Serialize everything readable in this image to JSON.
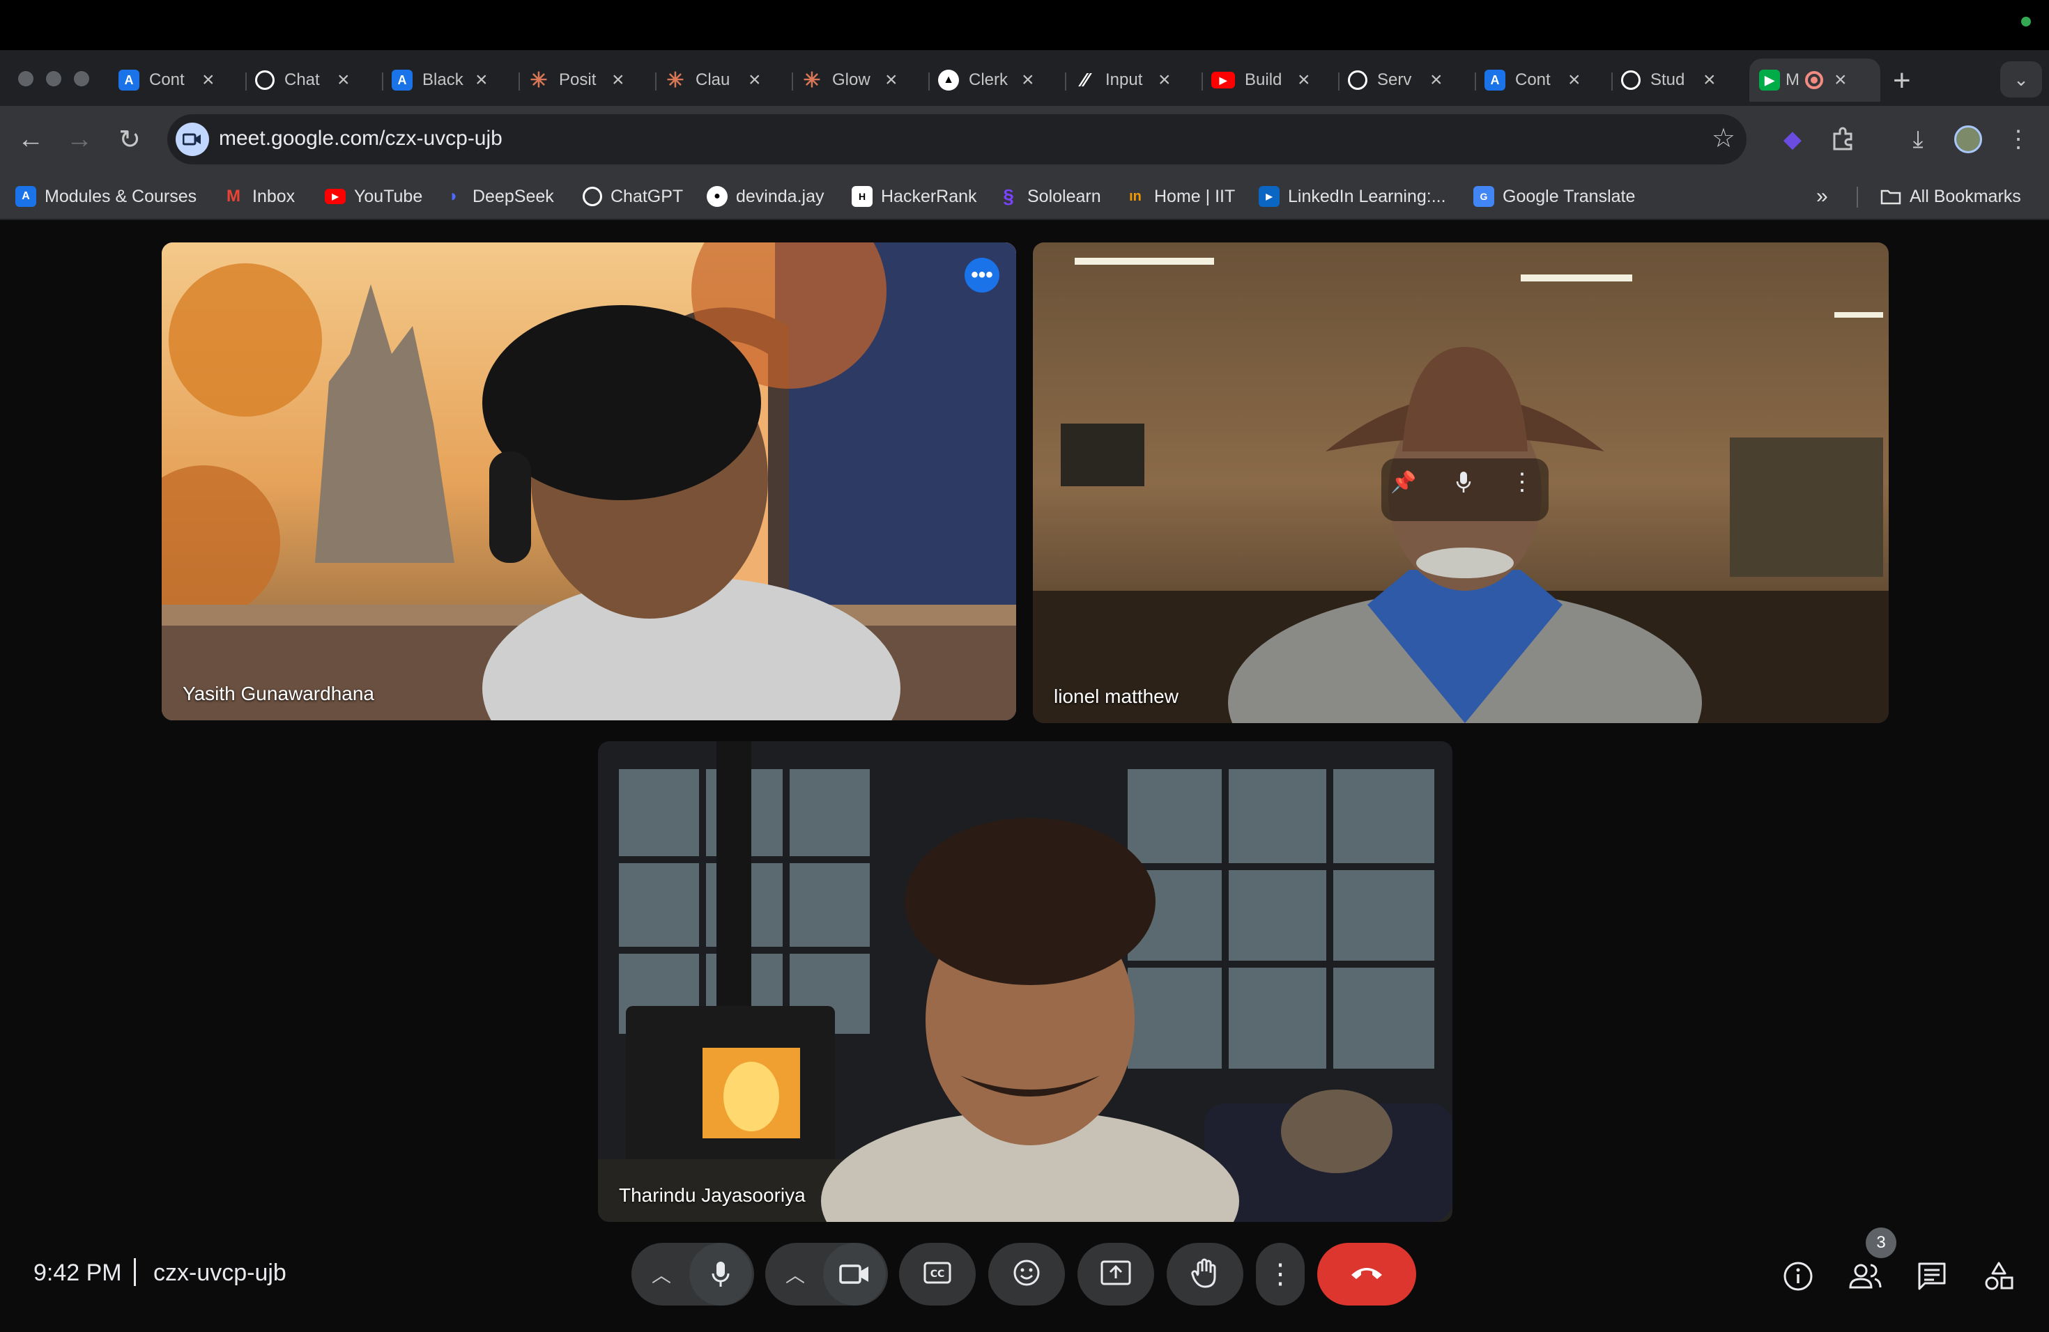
{
  "browser": {
    "tabs": [
      {
        "label": "Cont",
        "icon": "a-icon",
        "color": "#1a73e8"
      },
      {
        "label": "Chat",
        "icon": "openai-icon",
        "color": "#ffffff"
      },
      {
        "label": "Black",
        "icon": "a-icon",
        "color": "#1a73e8"
      },
      {
        "label": "Posit",
        "icon": "claude-icon",
        "color": "#d97757"
      },
      {
        "label": "Clau",
        "icon": "claude-icon",
        "color": "#d97757"
      },
      {
        "label": "Glow",
        "icon": "claude-icon",
        "color": "#d97757"
      },
      {
        "label": "Clerk",
        "icon": "clerk-icon",
        "color": "#ffffff"
      },
      {
        "label": "Input",
        "icon": "slash-icon",
        "color": "#ffffff"
      },
      {
        "label": "Build",
        "icon": "youtube-icon",
        "color": "#ff0000"
      },
      {
        "label": "Serv",
        "icon": "openai-icon",
        "color": "#ffffff"
      },
      {
        "label": "Cont",
        "icon": "a-icon",
        "color": "#1a73e8"
      },
      {
        "label": "Stud",
        "icon": "openai-icon",
        "color": "#ffffff"
      },
      {
        "label": "M",
        "icon": "meet-icon",
        "color": "#00ac47",
        "active": true
      }
    ],
    "url": "meet.google.com/czx-uvcp-ujb",
    "bookmarks": [
      {
        "label": "Modules & Courses",
        "icon": "a-icon",
        "color": "#1a73e8"
      },
      {
        "label": "Inbox",
        "icon": "gmail-icon",
        "color": "#ea4335"
      },
      {
        "label": "YouTube",
        "icon": "youtube-icon",
        "color": "#ff0000"
      },
      {
        "label": "DeepSeek",
        "icon": "deepseek-icon",
        "color": "#4d6bfe"
      },
      {
        "label": "ChatGPT",
        "icon": "openai-icon",
        "color": "#ffffff"
      },
      {
        "label": "devinda.jay",
        "icon": "github-icon",
        "color": "#ffffff"
      },
      {
        "label": "HackerRank",
        "icon": "hackerrank-icon",
        "color": "#ffffff"
      },
      {
        "label": "Sololearn",
        "icon": "sololearn-icon",
        "color": "#7a43ff"
      },
      {
        "label": "Home | IIT",
        "icon": "iit-icon",
        "color": "#f29900"
      },
      {
        "label": "LinkedIn Learning:...",
        "icon": "linkedin-learning-icon",
        "color": "#0a66c2"
      },
      {
        "label": "Google Translate",
        "icon": "translate-icon",
        "color": "#4285f4"
      }
    ],
    "all_bookmarks": "All Bookmarks"
  },
  "meeting": {
    "participants": [
      {
        "name": "Yasith Gunawardhana",
        "speaking": true
      },
      {
        "name": "lionel matthew"
      },
      {
        "name": "Tharindu Jayasooriya"
      }
    ],
    "time": "9:42 PM",
    "code": "czx-uvcp-ujb",
    "participant_count": "3",
    "accent_color": "#8ab4f8",
    "end_call_color": "#dc362e"
  }
}
